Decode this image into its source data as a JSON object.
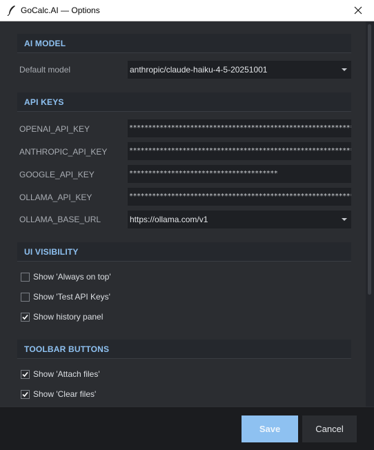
{
  "window": {
    "title": "GoCalc.AI — Options"
  },
  "sections": {
    "ai_model": "AI MODEL",
    "api_keys": "API KEYS",
    "ui_visibility": "UI VISIBILITY",
    "toolbar_buttons": "TOOLBAR BUTTONS"
  },
  "ai_model": {
    "default_model_label": "Default model",
    "default_model_value": "anthropic/claude-haiku-4-5-20251001"
  },
  "api_keys": [
    {
      "label": "OPENAI_API_KEY",
      "value": "****************************************************************************************************"
    },
    {
      "label": "ANTHROPIC_API_KEY",
      "value": "****************************************************************************************************"
    },
    {
      "label": "GOOGLE_API_KEY",
      "value": "***************************************"
    },
    {
      "label": "OLLAMA_API_KEY",
      "value": "*************************************************************"
    }
  ],
  "ollama_base_url": {
    "label": "OLLAMA_BASE_URL",
    "value": "https://ollama.com/v1"
  },
  "ui_visibility": [
    {
      "label": "Show 'Always on top'",
      "checked": false
    },
    {
      "label": "Show 'Test API Keys'",
      "checked": false
    },
    {
      "label": "Show history panel",
      "checked": true
    }
  ],
  "toolbar_buttons": [
    {
      "label": "Show 'Attach files'",
      "checked": true
    },
    {
      "label": "Show 'Clear files'",
      "checked": true
    }
  ],
  "footer": {
    "save_label": "Save",
    "cancel_label": "Cancel"
  },
  "colors": {
    "accent": "#8ec1f1",
    "background": "#2b2d31",
    "field_background": "#1e2024"
  },
  "icons": [
    "feather-icon",
    "close-icon",
    "chevron-down-icon",
    "checkmark-icon"
  ]
}
